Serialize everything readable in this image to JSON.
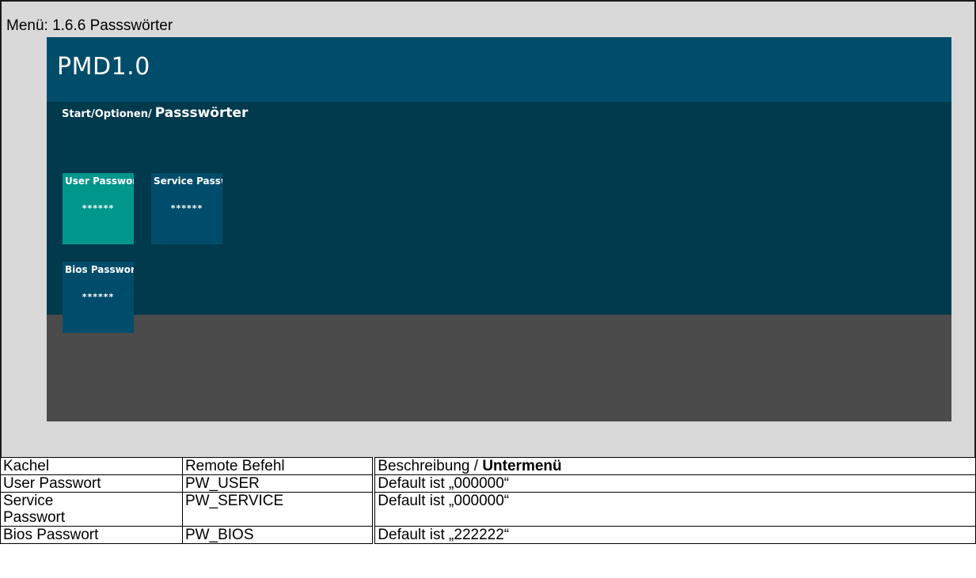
{
  "heading": "Menü: 1.6.6 Passswörter",
  "app": {
    "title": "PMD1.0",
    "breadcrumb_path": "Start/Optionen/",
    "breadcrumb_current": "Passswörter"
  },
  "tiles": [
    {
      "label": "User Passwort",
      "value": "******",
      "state": "selected"
    },
    {
      "label": "Service Passwort",
      "value": "******",
      "state": "normal"
    },
    {
      "label": "Bios Passwort",
      "value": "******",
      "state": "normal"
    }
  ],
  "table": {
    "headers": {
      "kachel": "Kachel",
      "remote": "Remote Befehl",
      "desc_prefix": "Beschreibung / ",
      "desc_bold": "Untermenü"
    },
    "rows": [
      {
        "kachel": "User Passwort",
        "remote": "PW_USER",
        "desc": "Default ist „000000“"
      },
      {
        "kachel": "Service Passwort",
        "remote": "PW_SERVICE",
        "desc": "Default ist „000000“"
      },
      {
        "kachel": "Bios Passwort",
        "remote": "PW_BIOS",
        "desc": "Default ist „222222“"
      }
    ]
  },
  "colors": {
    "header": "#004d6b",
    "content": "#003a4c",
    "tile_selected": "#00968c",
    "tile_normal": "#004d6b",
    "footer": "#4b4b4b"
  }
}
